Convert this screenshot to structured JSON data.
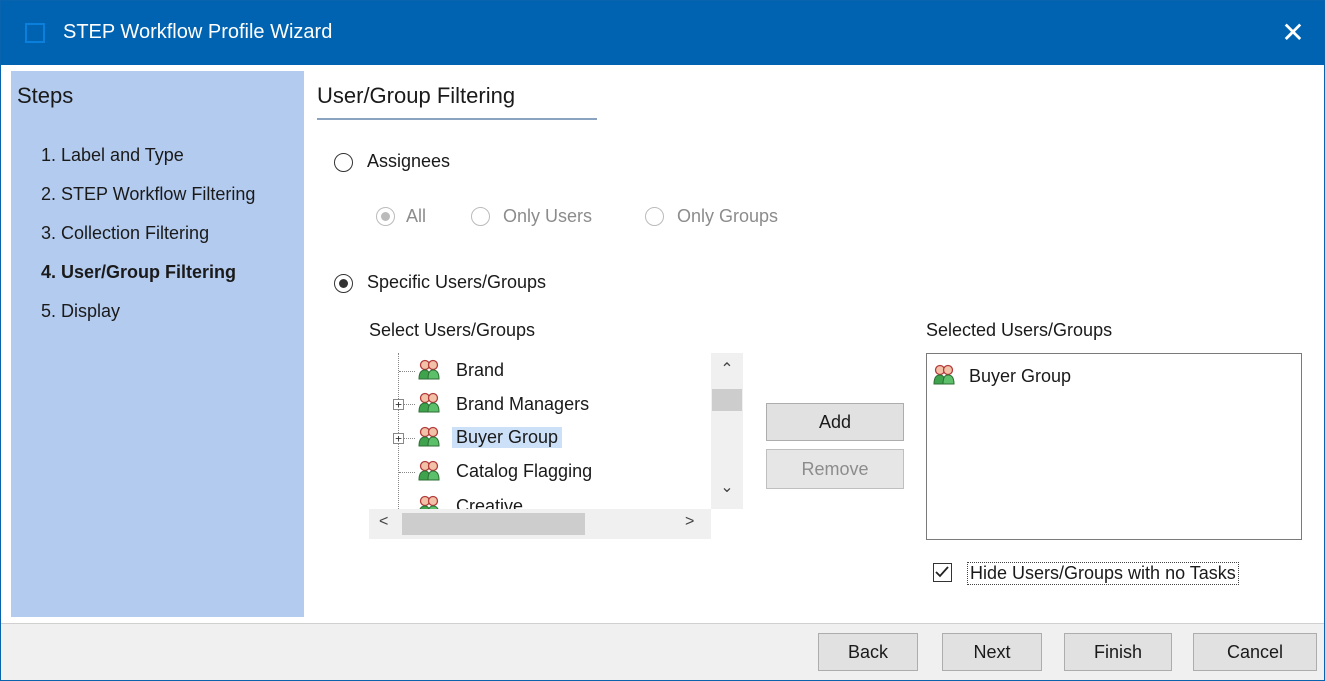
{
  "window": {
    "title": "STEP Workflow Profile Wizard",
    "close_symbol": "✕"
  },
  "steps": {
    "heading": "Steps",
    "items": [
      {
        "label": "1. Label and Type"
      },
      {
        "label": "2. STEP Workflow Filtering"
      },
      {
        "label": "3. Collection Filtering"
      },
      {
        "label": "4. User/Group Filtering",
        "current": true
      },
      {
        "label": "5. Display"
      }
    ]
  },
  "main": {
    "section_title": "User/Group Filtering",
    "assignees": {
      "label": "Assignees",
      "selected": false,
      "options": [
        {
          "label": "All",
          "checked": true
        },
        {
          "label": "Only Users",
          "checked": false
        },
        {
          "label": "Only Groups",
          "checked": false
        }
      ]
    },
    "specific": {
      "label": "Specific Users/Groups",
      "selected": true
    },
    "select_tree": {
      "label": "Select Users/Groups",
      "items": [
        {
          "label": "Brand",
          "expandable": false
        },
        {
          "label": "Brand Managers",
          "expandable": true
        },
        {
          "label": "Buyer Group",
          "expandable": true,
          "selected": true
        },
        {
          "label": "Catalog Flagging",
          "expandable": false
        },
        {
          "label": "Creative",
          "expandable": false
        }
      ]
    },
    "add_label": "Add",
    "remove_label": "Remove",
    "selected_list": {
      "label": "Selected Users/Groups",
      "items": [
        {
          "label": "Buyer Group"
        }
      ]
    },
    "hide_checkbox": {
      "label": "Hide Users/Groups with no Tasks",
      "checked": true
    }
  },
  "footer": {
    "back": "Back",
    "next": "Next",
    "finish": "Finish",
    "cancel": "Cancel"
  },
  "colors": {
    "titlebar": "#0063b1",
    "steps_panel": "#b3cbee",
    "selection": "#cce0f7"
  },
  "icons": [
    "app-icon",
    "close-icon",
    "group-icon",
    "expand-plus-icon",
    "scroll-up-icon",
    "scroll-down-icon",
    "scroll-left-icon",
    "scroll-right-icon",
    "checkmark-icon"
  ]
}
